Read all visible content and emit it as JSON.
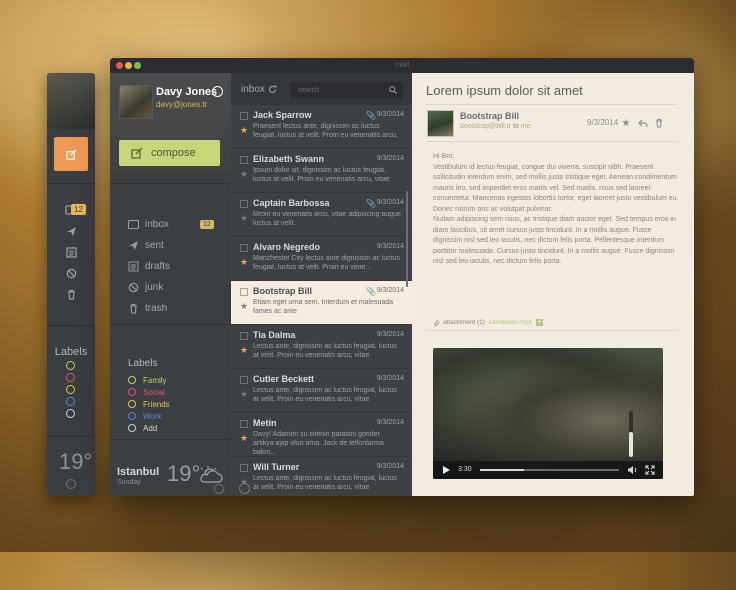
{
  "app": {
    "window_title": "mail"
  },
  "mini_sidebar": {
    "badge": "12",
    "labels_title": "Labels",
    "temperature": "19°",
    "label_colors": [
      "#b8d46a",
      "#e0566b",
      "#e8c44e",
      "#5f86d8",
      "#cfd2d6"
    ]
  },
  "profile": {
    "name": "Davy Jones",
    "email": "davy@jones.tr"
  },
  "compose": {
    "label": "compose"
  },
  "nav": {
    "items": [
      {
        "label": "inbox",
        "icon": "inbox-icon"
      },
      {
        "label": "sent",
        "icon": "send-icon"
      },
      {
        "label": "drafts",
        "icon": "drafts-icon"
      },
      {
        "label": "junk",
        "icon": "junk-icon"
      },
      {
        "label": "trash",
        "icon": "trash-icon"
      }
    ],
    "inbox_badge": "12"
  },
  "labels": {
    "title": "Labels",
    "items": [
      {
        "label": "Family",
        "color": "#b8d46a"
      },
      {
        "label": "Social",
        "color": "#e0566b"
      },
      {
        "label": "Friends",
        "color": "#e8c44e"
      },
      {
        "label": "Work",
        "color": "#5f86d8"
      },
      {
        "label": "Add",
        "color": "#cfd2d6"
      }
    ]
  },
  "weather": {
    "city": "Istanbul",
    "day": "Sunday",
    "temp": "19°"
  },
  "list": {
    "heading": "inbox",
    "search_placeholder": "search",
    "messages": [
      {
        "from": "Jack Sparrow",
        "date": "9/3/2014",
        "attachment": true,
        "starred": true,
        "snippet": "Praesent lectus ante, dignissim ac luctus feugiat, luctus at velit. Proin eu venenatis arcu,"
      },
      {
        "from": "Elizabeth Swann",
        "date": "9/3/2014",
        "attachment": false,
        "starred": false,
        "snippet": "Ipsum dolor sit, dignissim ac luctus feugiat, luctus at velit. Proin eu venenatis arcu, vitae"
      },
      {
        "from": "Captain Barbossa",
        "date": "9/3/2014",
        "attachment": true,
        "starred": false,
        "snippet": "Mroin eu venenatis arcu, vitae adipiscing augue luctus at velit."
      },
      {
        "from": "Alvaro Negredo",
        "date": "9/3/2014",
        "attachment": false,
        "starred": true,
        "snippet": "Manchester City lectus ante dignissim ac luctus feugiat, luctus at velit. Proin eu vene..."
      },
      {
        "from": "Bootstrap Bill",
        "date": "9/3/2014",
        "attachment": true,
        "starred": false,
        "snippet": "Etiam eget urna sem. Interdum et malesuada fames ac ante",
        "selected": true
      },
      {
        "from": "Tia Dalma",
        "date": "9/3/2014",
        "attachment": false,
        "starred": true,
        "snippet": "Lectus ante, dignissim ac luctus feugiat, luctus at velit. Proin eu venenatis arcu, vitae"
      },
      {
        "from": "Cutler Beckett",
        "date": "9/3/2014",
        "attachment": false,
        "starred": false,
        "snippet": "Lectus ante, dignissim ac luctus feugiat, luctus at velit. Proin eu venenatis arcu, vitae"
      },
      {
        "from": "Metin",
        "date": "9/3/2014",
        "attachment": false,
        "starred": true,
        "snippet": "Davy! Adamim su sitenin parasini gonder artikya ayip oluo ama. Jack de telfonlarma bakm..."
      },
      {
        "from": "Will Turner",
        "date": "9/3/2014",
        "attachment": false,
        "starred": false,
        "snippet": "Lectus ante, dignissim ac luctus feugiat, luctus at velit. Proin eu venenatis arcu, vitae"
      }
    ]
  },
  "reader": {
    "subject": "Lorem ipsum dolor sit amet",
    "sender_name": "Bootstrap Bill",
    "sender_email": "bootstrap@bill.tr",
    "to_word": "to",
    "recipient": "me",
    "date": "9/3/2014",
    "greeting": "Hi Bro,",
    "para1": "Vestibulum id lectus feugiat, congue dui viverra, suscipit nibh. Praesent sollicitudin interdum enim, sed mollis justo tristique eget. Aenean condimentum mauris leo, sed imperdiet eros mattis vel. Sed mattis, risus sed laoreet consectetur. Maecenas egestas lobortis tortor, eget laoreet justo vestibulum eu. Donec rutrum orci ac volutpat pulvinar.",
    "para2": "Nullam adipiscing sem risus, ac tristique diam auctor eget. Sed tempus eros in diam faucibus, sit amet cursus justo tincidunt. In a mollis augue. Fusce dignissim nisl sed leo iaculis, nec dictum felis porta. Pellentesque interdum porttitor malesuada. Cursus justo tincidunt. In a mollis augue. Fusce dignissim nisl sed leo iaculis, nec dictum felis porta.",
    "attachment_label": "attachment (1)",
    "attachment_file": "caribbean.mp4",
    "video": {
      "time": "3:30",
      "progress": 0.32,
      "volume": 0.55
    }
  },
  "colors": {
    "accent_orange": "#ee9a56",
    "accent_green": "#c6d67a",
    "dark_panel": "#3a3d42",
    "reading_bg": "#f1ebe0"
  }
}
